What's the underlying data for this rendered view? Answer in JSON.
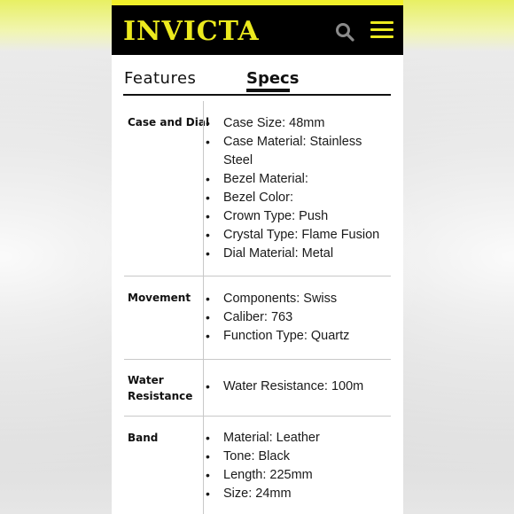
{
  "brand": {
    "logo_text": "INVICTA",
    "accent_color": "#ecea1e"
  },
  "header": {
    "search_icon": "search-icon",
    "menu_icon": "hamburger-menu-icon"
  },
  "tabs": [
    {
      "label": "Features",
      "active": false
    },
    {
      "label": "Specs",
      "active": true
    }
  ],
  "specs": [
    {
      "label": "Case and Dial",
      "items": [
        "Case Size: 48mm",
        "Case Material: Stainless Steel",
        "Bezel Material:",
        "Bezel Color:",
        "Crown Type: Push",
        "Crystal Type: Flame Fusion",
        "Dial Material: Metal"
      ]
    },
    {
      "label": "Movement",
      "items": [
        "Components: Swiss",
        "Caliber: 763",
        "Function Type: Quartz"
      ]
    },
    {
      "label": "Water Resistance",
      "items": [
        "Water Resistance: 100m"
      ]
    },
    {
      "label": "Band",
      "items": [
        "Material: Leather",
        "Tone: Black",
        "Length: 225mm",
        "Size: 24mm"
      ]
    }
  ]
}
